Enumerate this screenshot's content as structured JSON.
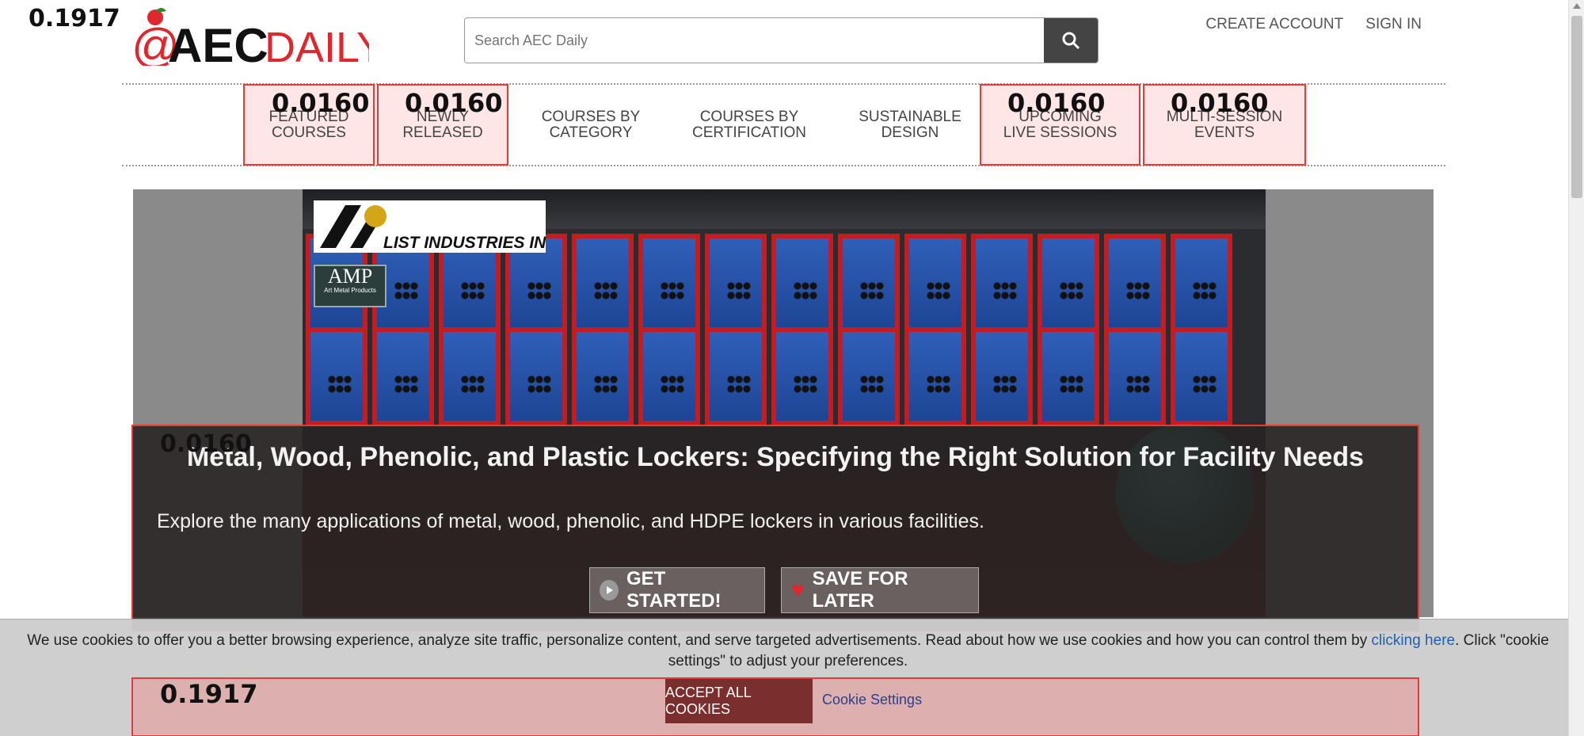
{
  "scores": {
    "page": "0.1917",
    "featured": "0.0160",
    "newly": "0.0160",
    "upcoming": "0.0160",
    "multi": "0.0160",
    "hero": "0.0160",
    "cookie": "0.1917"
  },
  "logo": {
    "at": "@",
    "aec": "AEC",
    "daily": "DAILY"
  },
  "search": {
    "placeholder": "Search AEC Daily",
    "icon": "search-icon"
  },
  "header": {
    "create_account": "CREATE ACCOUNT",
    "sign_in": "SIGN IN"
  },
  "nav": {
    "featured": "FEATURED\nCOURSES",
    "newly": "NEWLY\nRELEASED",
    "category": "COURSES BY\nCATEGORY",
    "certification": "COURSES BY\nCERTIFICATION",
    "sustainable": "SUSTAINABLE\nDESIGN",
    "upcoming": "UPCOMING\nLIVE SESSIONS",
    "multi": "MULTI-SESSION\nEVENTS"
  },
  "hero": {
    "brand1": "LIST INDUSTRIES INC.",
    "brand2_big": "AMP",
    "brand2_small": "Art Metal Products",
    "title": "Metal, Wood, Phenolic, and Plastic Lockers: Specifying the Right Solution for Facility Needs",
    "subtitle": "Explore the many applications of metal, wood, phenolic, and HDPE lockers in various facilities.",
    "get_started": "GET STARTED!",
    "save_later": "SAVE FOR LATER"
  },
  "cookie": {
    "text_before": " We use cookies to offer you a better browsing experience, analyze site traffic, personalize content, and serve targeted advertisements. Read about how we use cookies and how you can control them by ",
    "link": "clicking here",
    "text_after": ". Click \"cookie settings\" to adjust your preferences.",
    "accept": "ACCEPT ALL COOKIES",
    "settings": "Cookie Settings"
  },
  "colors": {
    "brand_red": "#e1262d",
    "box_red": "#e43a3a",
    "link_blue": "#1e5fb0"
  }
}
